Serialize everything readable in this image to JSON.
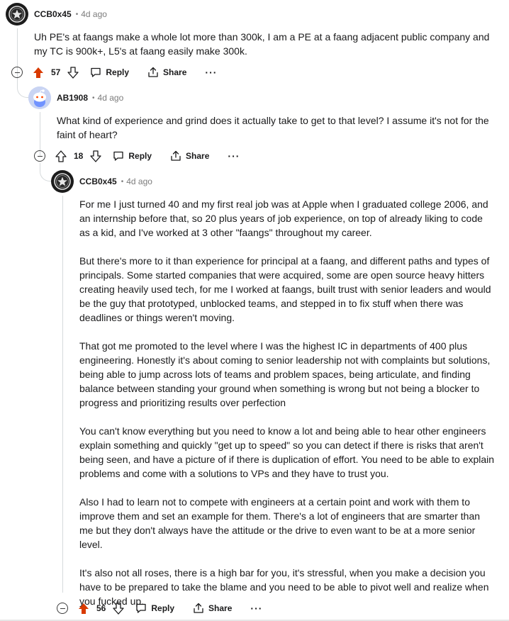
{
  "comments": [
    {
      "username": "CCB0x45",
      "separator": "•",
      "age": "4d ago",
      "paragraphs": [
        "Uh PE's at faangs make a whole lot more than 300k, I am a PE at a faang adjacent public company and my TC is 900k+, L5's at faang easily make 300k."
      ],
      "votes": "57",
      "upvoted": true,
      "reply_label": "Reply",
      "share_label": "Share",
      "more_label": "···"
    },
    {
      "username": "AB1908",
      "separator": "•",
      "age": "4d ago",
      "paragraphs": [
        "What kind of experience and grind does it actually take to get to that level? I assume it's not for the faint of heart?"
      ],
      "votes": "18",
      "upvoted": false,
      "reply_label": "Reply",
      "share_label": "Share",
      "more_label": "···"
    },
    {
      "username": "CCB0x45",
      "separator": "•",
      "age": "4d ago",
      "paragraphs": [
        "For me I just turned 40 and my first real job was at Apple when I graduated college 2006, and an internship before that, so 20 plus years of job experience, on top of already liking to code as a kid, and I've worked at 3 other \"faangs\" throughout my career.",
        "But there's more to it than experience for principal at a faang, and different paths and types of principals. Some started companies that were acquired, some are open source heavy hitters creating heavily used tech, for me I worked at faangs, built trust with senior leaders and would be the guy that prototyped, unblocked teams, and stepped in to fix stuff when there was deadlines or things weren't moving.",
        "That got me promoted to the level where I was the highest IC in departments of 400 plus engineering. Honestly it's about coming to senior leadership not with complaints but solutions, being able to jump across lots of teams and problem spaces, being articulate, and finding balance between standing your ground when something is wrong but not being a blocker to progress and prioritizing results over perfection",
        "You can't know everything but you need to know a lot and being able to hear other engineers explain something and quickly \"get up to speed\" so you can detect if there is risks that aren't being seen, and have a picture of if there is duplication of effort. You need to be able to explain problems and come with a solutions to VPs and they have to trust you.",
        "Also I had to learn not to compete with engineers at a certain point and work with them to improve them and set an example for them. There's a lot of engineers that are smarter than me but they don't always have the attitude or the drive to even want to be at a more senior level.",
        "It's also not all roses, there is a high bar for you, it's stressful, when you make a decision you have to be prepared to take the blame and you need to be able to pivot well and realize when you fucked up."
      ],
      "votes": "56",
      "upvoted": true,
      "reply_label": "Reply",
      "share_label": "Share",
      "more_label": "···"
    }
  ],
  "colors": {
    "upvote_active": "#d93a00",
    "text": "#1a1a1b",
    "muted": "#7c7c7c",
    "thread_line": "#d6dadc"
  },
  "icons": {
    "avatar_ccb": "star-badge-icon",
    "avatar_ab": "snoo-avatar-icon",
    "upvote": "arrow-up-icon",
    "downvote": "arrow-down-icon",
    "reply": "speech-bubble-icon",
    "share": "share-icon",
    "collapse": "minus-circle-icon"
  }
}
